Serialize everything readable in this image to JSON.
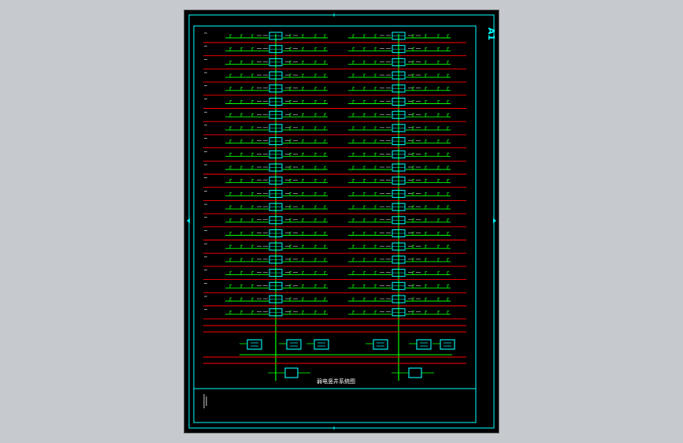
{
  "drawing": {
    "sheet_size": "A1",
    "title": "弱电竖井系统图",
    "colors": {
      "background": "#000000",
      "viewport": "#c6c9cd",
      "frame": "#00ffff",
      "floor_line": "#ff0000",
      "circuit": "#00ff00",
      "equipment": "#00ffff",
      "label": "#ffffff"
    }
  }
}
